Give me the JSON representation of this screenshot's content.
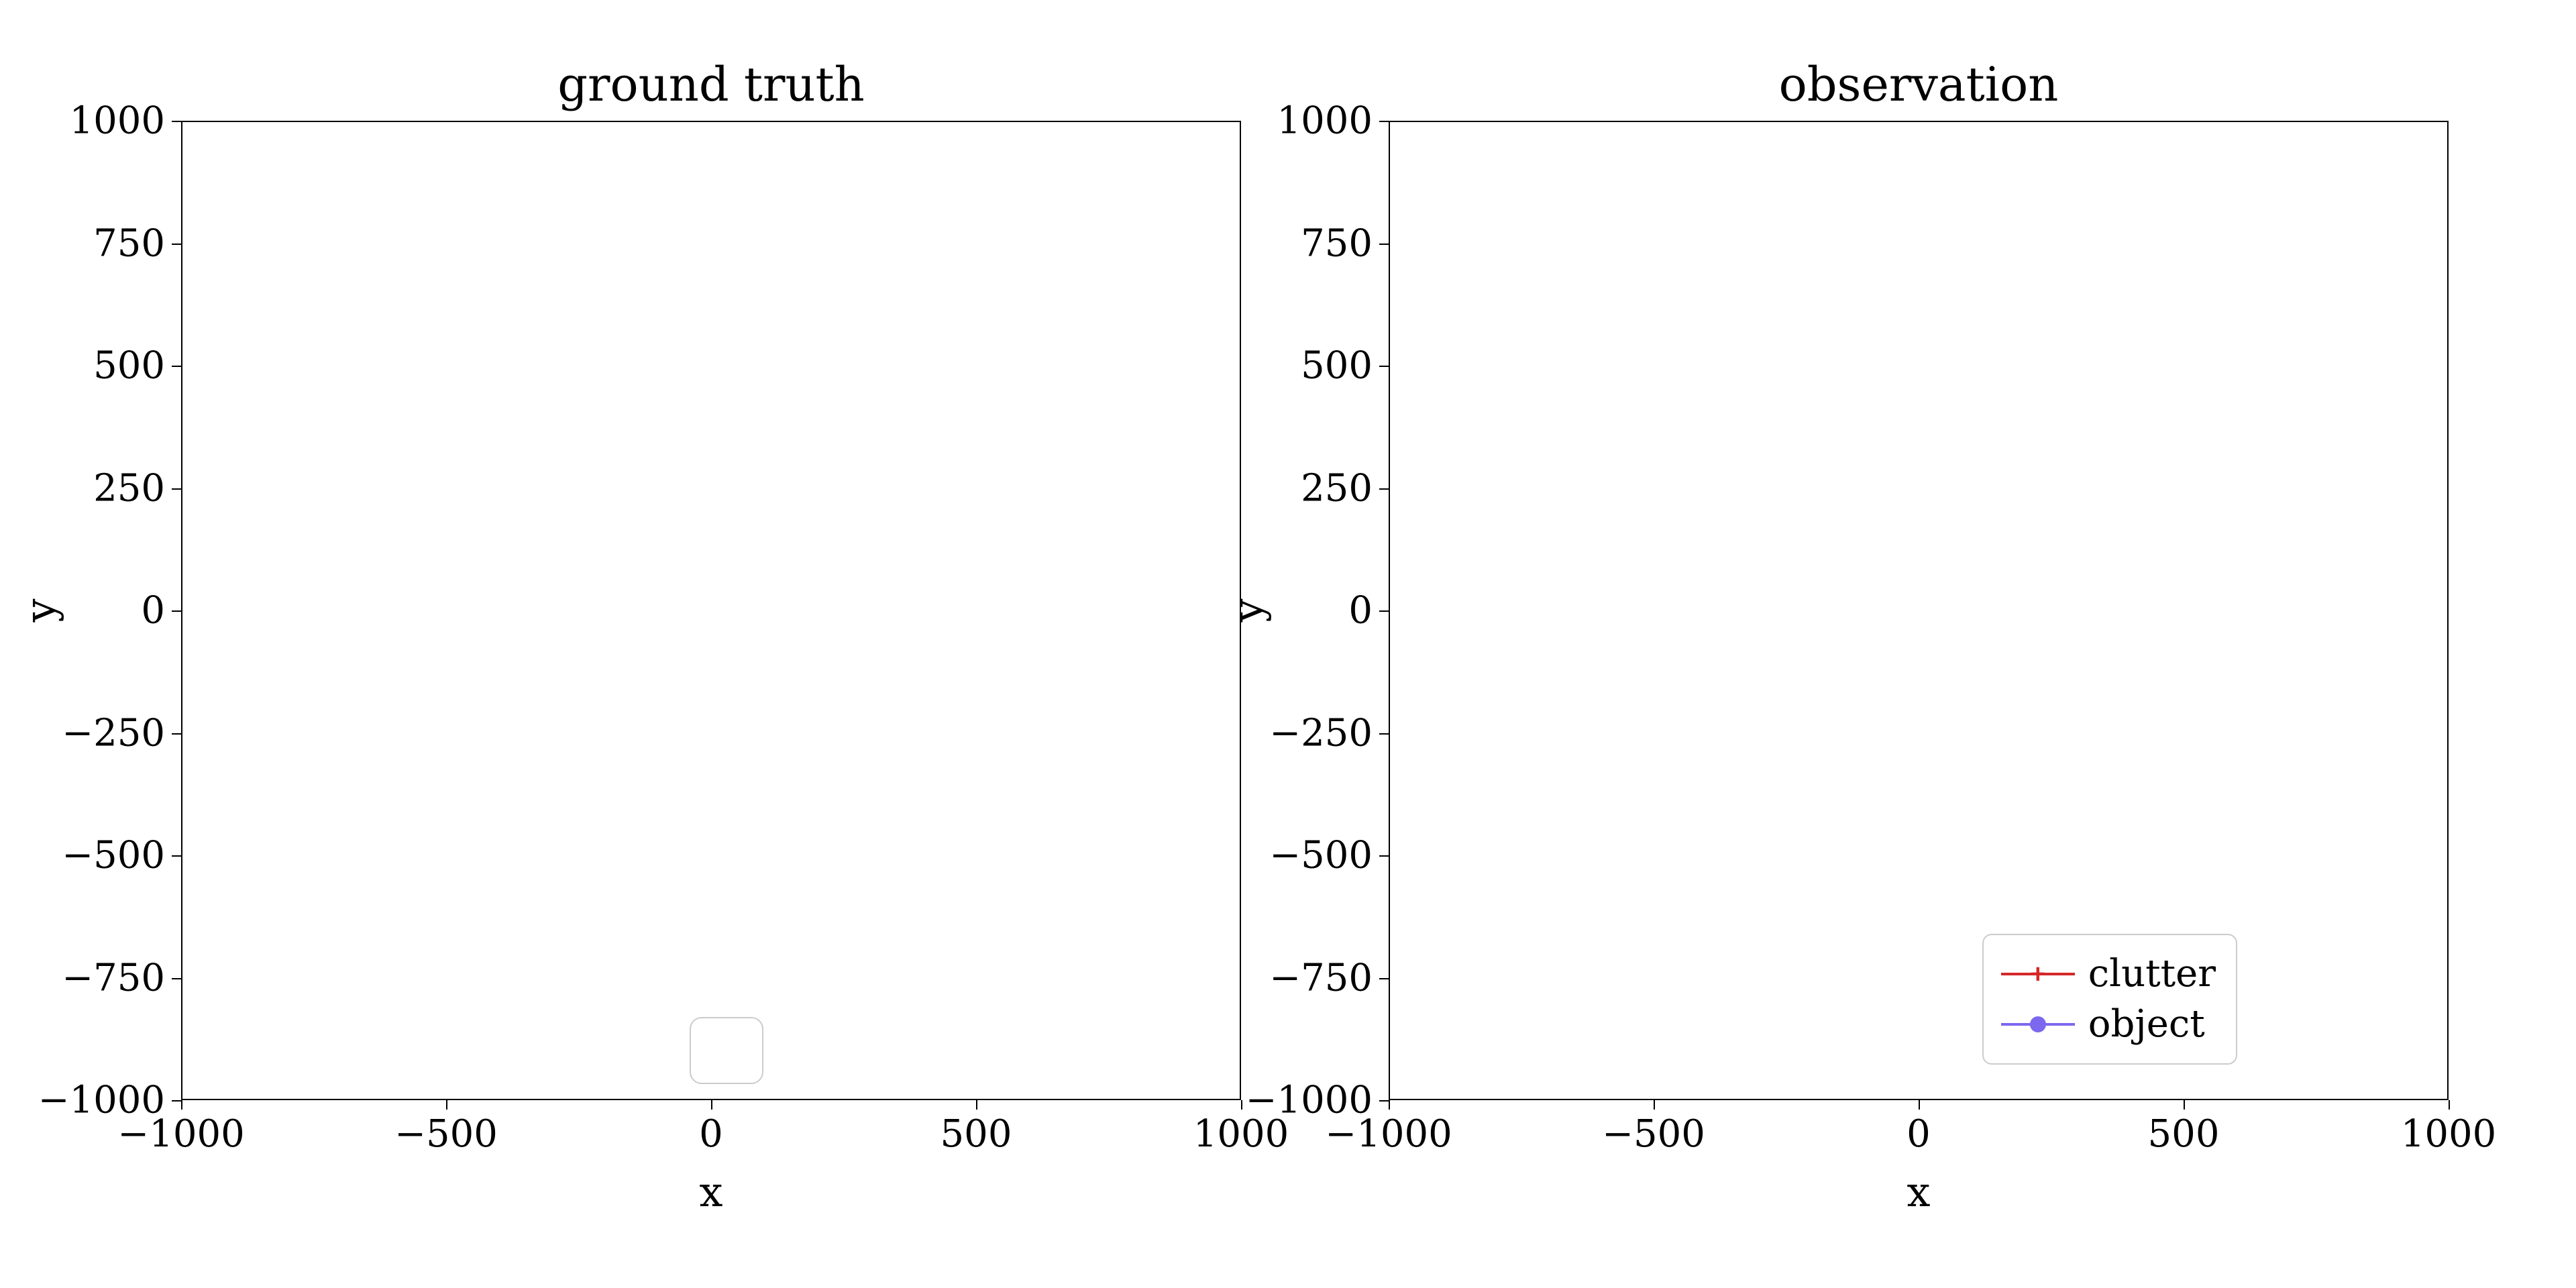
{
  "chart_data": [
    {
      "type": "scatter",
      "title": "ground truth",
      "xlabel": "x",
      "ylabel": "y",
      "xlim": [
        -1000,
        1000
      ],
      "ylim": [
        -1000,
        1000
      ],
      "xticks": [
        -1000,
        -500,
        0,
        500,
        1000
      ],
      "yticks": [
        -1000,
        -750,
        -500,
        -250,
        0,
        250,
        500,
        750,
        1000
      ],
      "series": []
    },
    {
      "type": "scatter",
      "title": "observation",
      "xlabel": "x",
      "ylabel": "y",
      "xlim": [
        -1000,
        1000
      ],
      "ylim": [
        -1000,
        1000
      ],
      "xticks": [
        -1000,
        -500,
        0,
        500,
        1000
      ],
      "yticks": [
        -1000,
        -750,
        -500,
        -250,
        0,
        250,
        500,
        750,
        1000
      ],
      "series": [
        {
          "name": "clutter",
          "marker": "plus",
          "color": "#d62728",
          "values": []
        },
        {
          "name": "object",
          "marker": "dot",
          "color": "#7b68ee",
          "values": []
        }
      ]
    }
  ],
  "legend": {
    "items": [
      {
        "label": "clutter",
        "color": "#d62728",
        "marker": "plus"
      },
      {
        "label": "object",
        "color": "#7b68ee",
        "marker": "dot"
      }
    ]
  },
  "ticks": {
    "x_labels": [
      "−1000",
      "−500",
      "0",
      "500",
      "1000"
    ],
    "y_labels": [
      "−1000",
      "−750",
      "−500",
      "−250",
      "0",
      "250",
      "500",
      "750",
      "1000"
    ]
  }
}
